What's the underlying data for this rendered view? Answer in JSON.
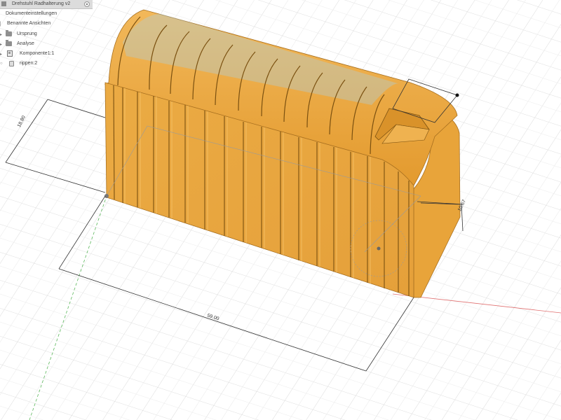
{
  "browser": {
    "title": "Drehstuhl Radhalterung v2",
    "items": [
      {
        "label": "Dokumenteinstellungen",
        "icon": "settings-gear-icon"
      },
      {
        "label": "Benannte Ansichten",
        "icon": "folder-icon"
      },
      {
        "label": "Ursprung",
        "icon": "folder-icon"
      },
      {
        "label": "Analyse",
        "icon": "folder-icon"
      },
      {
        "label": "Komponente1:1",
        "icon": "component-icon"
      },
      {
        "label": "rippen:2",
        "icon": "body-icon"
      }
    ]
  },
  "dimensions": {
    "height": "18.80",
    "length": "59.00",
    "depth": "10.67"
  },
  "colors": {
    "body": "#e8a43a",
    "rib_shadow": "#9a6a18",
    "grid": "#d0d0d0",
    "axis_red": "#e07070",
    "axis_green": "#5cb85c",
    "selection": "#a7d3ee"
  }
}
